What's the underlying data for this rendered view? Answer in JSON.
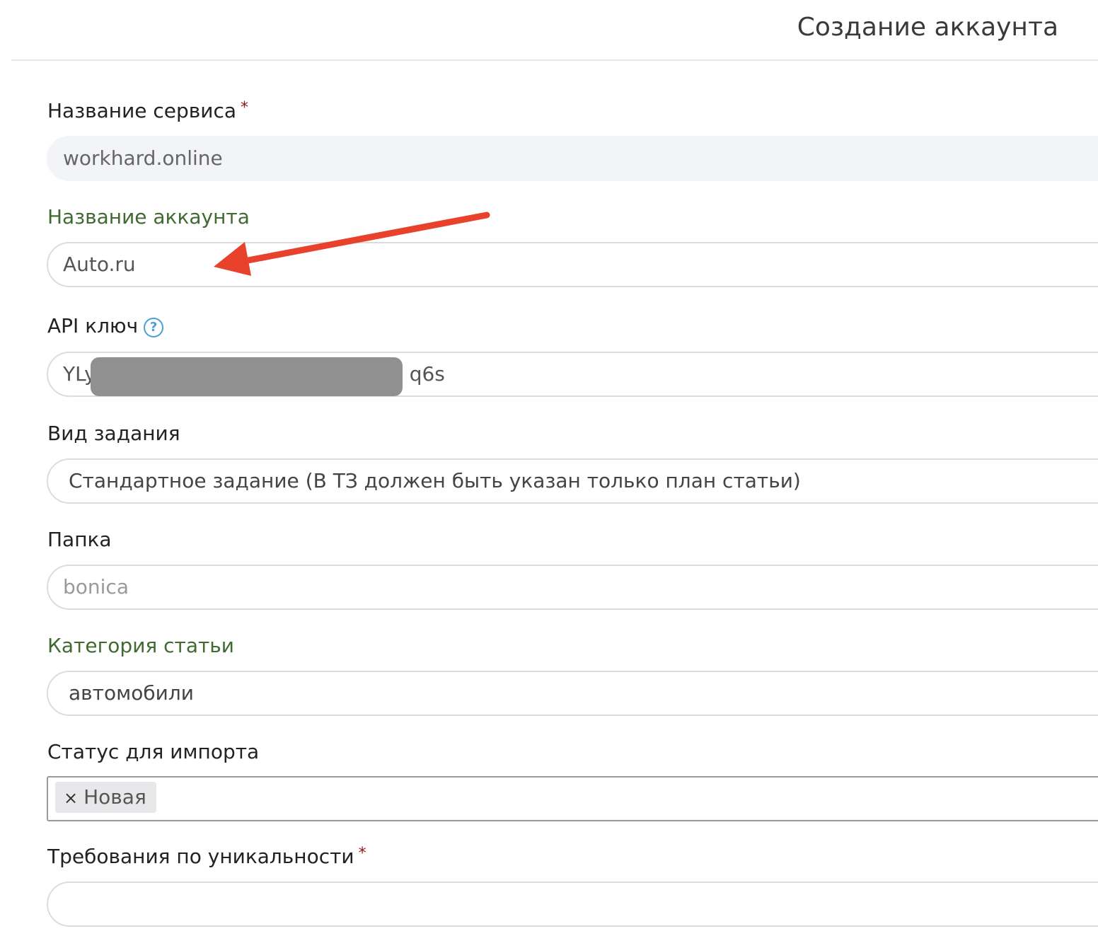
{
  "header": {
    "title": "Создание аккаунта"
  },
  "form": {
    "service_name": {
      "label": "Название сервиса",
      "required_mark": "*",
      "value": "workhard.online"
    },
    "account_name": {
      "label": "Название аккаунта",
      "value": "Auto.ru"
    },
    "api_key": {
      "label": "API ключ",
      "help_glyph": "?",
      "value_prefix": "YLy",
      "value_suffix": "q6s"
    },
    "task_type": {
      "label": "Вид задания",
      "value": "Стандартное задание (В ТЗ должен быть указан только план статьи)"
    },
    "folder": {
      "label": "Папка",
      "placeholder": "bonica"
    },
    "article_category": {
      "label": "Категория статьи",
      "value": "автомобили"
    },
    "import_status": {
      "label": "Статус для импорта",
      "tag_remove_glyph": "×",
      "tag": "Новая"
    },
    "uniqueness": {
      "label": "Требования по уникальности",
      "required_mark": "*",
      "value": ""
    }
  },
  "annotation": {
    "arrow_color": "#e8412c"
  },
  "colors": {
    "accent_label": "#3f6b32",
    "required": "#8b1a1a",
    "help": "#4a9fd8"
  }
}
